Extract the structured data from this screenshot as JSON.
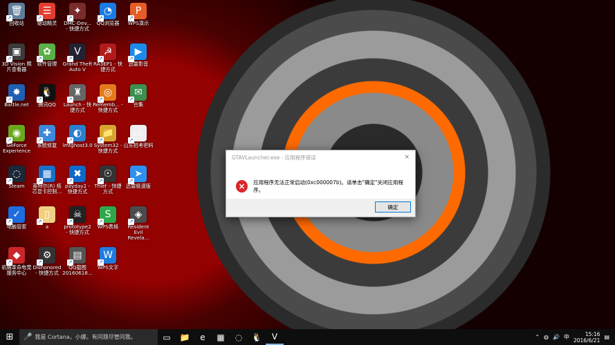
{
  "desktop_icons": [
    {
      "label": "回收站",
      "icon": "🗑",
      "bg": "#5f7c9a"
    },
    {
      "label": "驱动精灵",
      "icon": "☰",
      "bg": "#e43d2f"
    },
    {
      "label": "DMC-Dev... - 快捷方式",
      "icon": "✦",
      "bg": "#7a2b2b"
    },
    {
      "label": "QQ浏览器",
      "icon": "◔",
      "bg": "#1b7be3"
    },
    {
      "label": "WPS演示",
      "icon": "P",
      "bg": "#e65c28"
    },
    {
      "label": "3D Vision 照片查看器",
      "icon": "▣",
      "bg": "#3b3b3b"
    },
    {
      "label": "软件管理",
      "icon": "✿",
      "bg": "#5bb048"
    },
    {
      "label": "Grand Theft Auto V",
      "icon": "V",
      "bg": "#223"
    },
    {
      "label": "RA3EP1 - 快捷方式",
      "icon": "☭",
      "bg": "#b21b1b"
    },
    {
      "label": "迅雷影音",
      "icon": "▶",
      "bg": "#1c8be8"
    },
    {
      "label": "Battle.net",
      "icon": "✸",
      "bg": "#1e5fb4"
    },
    {
      "label": "腾讯QQ",
      "icon": "🐧",
      "bg": "#111"
    },
    {
      "label": "Launch - 快捷方式",
      "icon": "♜",
      "bg": "#666"
    },
    {
      "label": "Rememb... - 快捷方式",
      "icon": "◎",
      "bg": "#e67a1a"
    },
    {
      "label": "合集",
      "icon": "✉",
      "bg": "#3c8f4e"
    },
    {
      "label": "GeForce Experience",
      "icon": "◉",
      "bg": "#6aa71c"
    },
    {
      "label": "系统修复",
      "icon": "✚",
      "bg": "#3f87d9"
    },
    {
      "label": "lmtghost3.0",
      "icon": "◐",
      "bg": "#2a7fcf"
    },
    {
      "label": "System32 - 快捷方式",
      "icon": "📁",
      "bg": "#d7a52f"
    },
    {
      "label": "山东招考密码",
      "icon": "▭",
      "bg": "#eee"
    },
    {
      "label": "Steam",
      "icon": "◌",
      "bg": "#1b2838"
    },
    {
      "label": "英特尔(R) 核芯显卡控制...",
      "icon": "▦",
      "bg": "#1c6fc7"
    },
    {
      "label": "payday2 - 快捷方式",
      "icon": "✖",
      "bg": "#0f69c9"
    },
    {
      "label": "Thief - 快捷方式",
      "icon": "☉",
      "bg": "#333"
    },
    {
      "label": "迅雷极速版",
      "icon": "➤",
      "bg": "#2e90f0"
    },
    {
      "label": "电脑管家",
      "icon": "✓",
      "bg": "#1e6ce0"
    },
    {
      "label": "a",
      "icon": "▯",
      "bg": "#f0d080"
    },
    {
      "label": "prototype2 - 快捷方式",
      "icon": "☠",
      "bg": "#222"
    },
    {
      "label": "WPS表格",
      "icon": "S",
      "bg": "#2fa84a"
    },
    {
      "label": "Resident Evil Revela...",
      "icon": "◈",
      "bg": "#4b4b4b"
    },
    {
      "label": "机械革命电竞服务中心",
      "icon": "◆",
      "bg": "#c9252a"
    },
    {
      "label": "Dishonored - 快捷方式",
      "icon": "⚙",
      "bg": "#333"
    },
    {
      "label": "QQ截图 20160618...",
      "icon": "▤",
      "bg": "#555"
    },
    {
      "label": "WPS文字",
      "icon": "W",
      "bg": "#1f7be0"
    }
  ],
  "dialog": {
    "title": "GTAVLauncher.exe - 应用程序错误",
    "message": "应用程序无法正常启动(0xc000007b)。请单击\"确定\"关闭应用程序。",
    "ok_label": "确定",
    "close_symbol": "×"
  },
  "taskbar": {
    "start_symbol": "⊞",
    "search_placeholder": "我是 Cortana，小娜。有问题尽管问我。",
    "mic_symbol": "🎤",
    "time": "15:16",
    "date": "2016/6/21",
    "ime_label": "中"
  }
}
